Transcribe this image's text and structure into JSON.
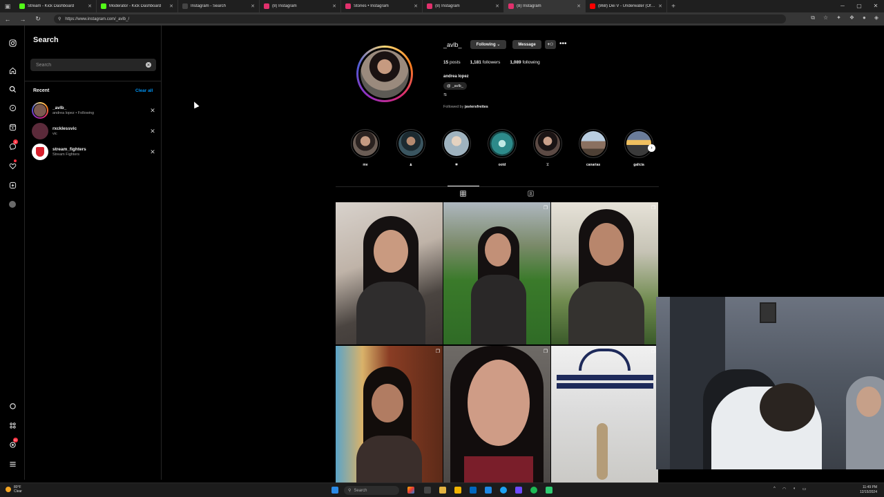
{
  "browser": {
    "tabs": [
      {
        "title": "Stream - Kick Dashboard",
        "color": "#53fc18",
        "active": false
      },
      {
        "title": "Moderator - Kick Dashboard",
        "color": "#53fc18",
        "active": false
      },
      {
        "title": "Instagram - Search",
        "color": "#444444",
        "active": false
      },
      {
        "title": "(8) Instagram",
        "color": "#e1306c",
        "active": false
      },
      {
        "title": "Stories • Instagram",
        "color": "#e1306c",
        "active": false
      },
      {
        "title": "(8) Instagram",
        "color": "#e1306c",
        "active": false
      },
      {
        "title": "(8) Instagram",
        "color": "#e1306c",
        "active": true
      },
      {
        "title": "(868) Dei V - Underwater (Offici",
        "color": "#ff0000",
        "active": false
      }
    ],
    "url": "https://www.instagram.com/_avlb_/"
  },
  "search": {
    "title": "Search",
    "placeholder": "Search",
    "recent_label": "Recent",
    "clear_all": "Clear all",
    "recent": [
      {
        "username": "_avlb_",
        "sub": "andrea lopez • Following",
        "avatar_color": "#7a5a50"
      },
      {
        "username": "rxcklessvic",
        "sub": "vic",
        "avatar_color": "#5b2a3a"
      },
      {
        "username": "stream_fighters",
        "sub": "Stream Fighters",
        "avatar_color": "#d61f2c"
      }
    ]
  },
  "profile": {
    "username": "_avlb_",
    "following_label": "Following",
    "message_label": "Message",
    "posts_count": "15",
    "posts_label": "posts",
    "followers_count": "1,181",
    "followers_label": "followers",
    "following_count": "1,089",
    "following_word": "following",
    "full_name": "andrea lopez",
    "threads_handle": "_avlb_",
    "bio": "♋",
    "followed_by_prefix": "Followed by",
    "followed_by_user": "javiersfreites",
    "highlights": [
      {
        "label": "me",
        "color": "#6b5d55"
      },
      {
        "label": "♟",
        "color": "#3a5560"
      },
      {
        "label": "✱",
        "color": "#9fb3bf"
      },
      {
        "label": "ootd",
        "color": "#2d8a8a"
      },
      {
        "label": "♊",
        "color": "#5c4a44"
      },
      {
        "label": "canarias",
        "color": "#8aa0b8"
      },
      {
        "label": "galicia",
        "color": "#d9a84a"
      }
    ]
  },
  "taskbar": {
    "weather_temp": "80°F",
    "weather_desc": "Clear",
    "search_label": "Search",
    "time": "11:49 PM",
    "date": "12/15/2024"
  },
  "icons": {
    "rail": [
      "instagram-icon",
      "home-icon",
      "search-icon",
      "explore-icon",
      "reels-icon",
      "messages-icon",
      "notifications-icon",
      "create-icon",
      "profile-icon",
      "threads-icon",
      "also-from-meta-icon",
      "meta-notification-icon",
      "more-icon"
    ]
  }
}
